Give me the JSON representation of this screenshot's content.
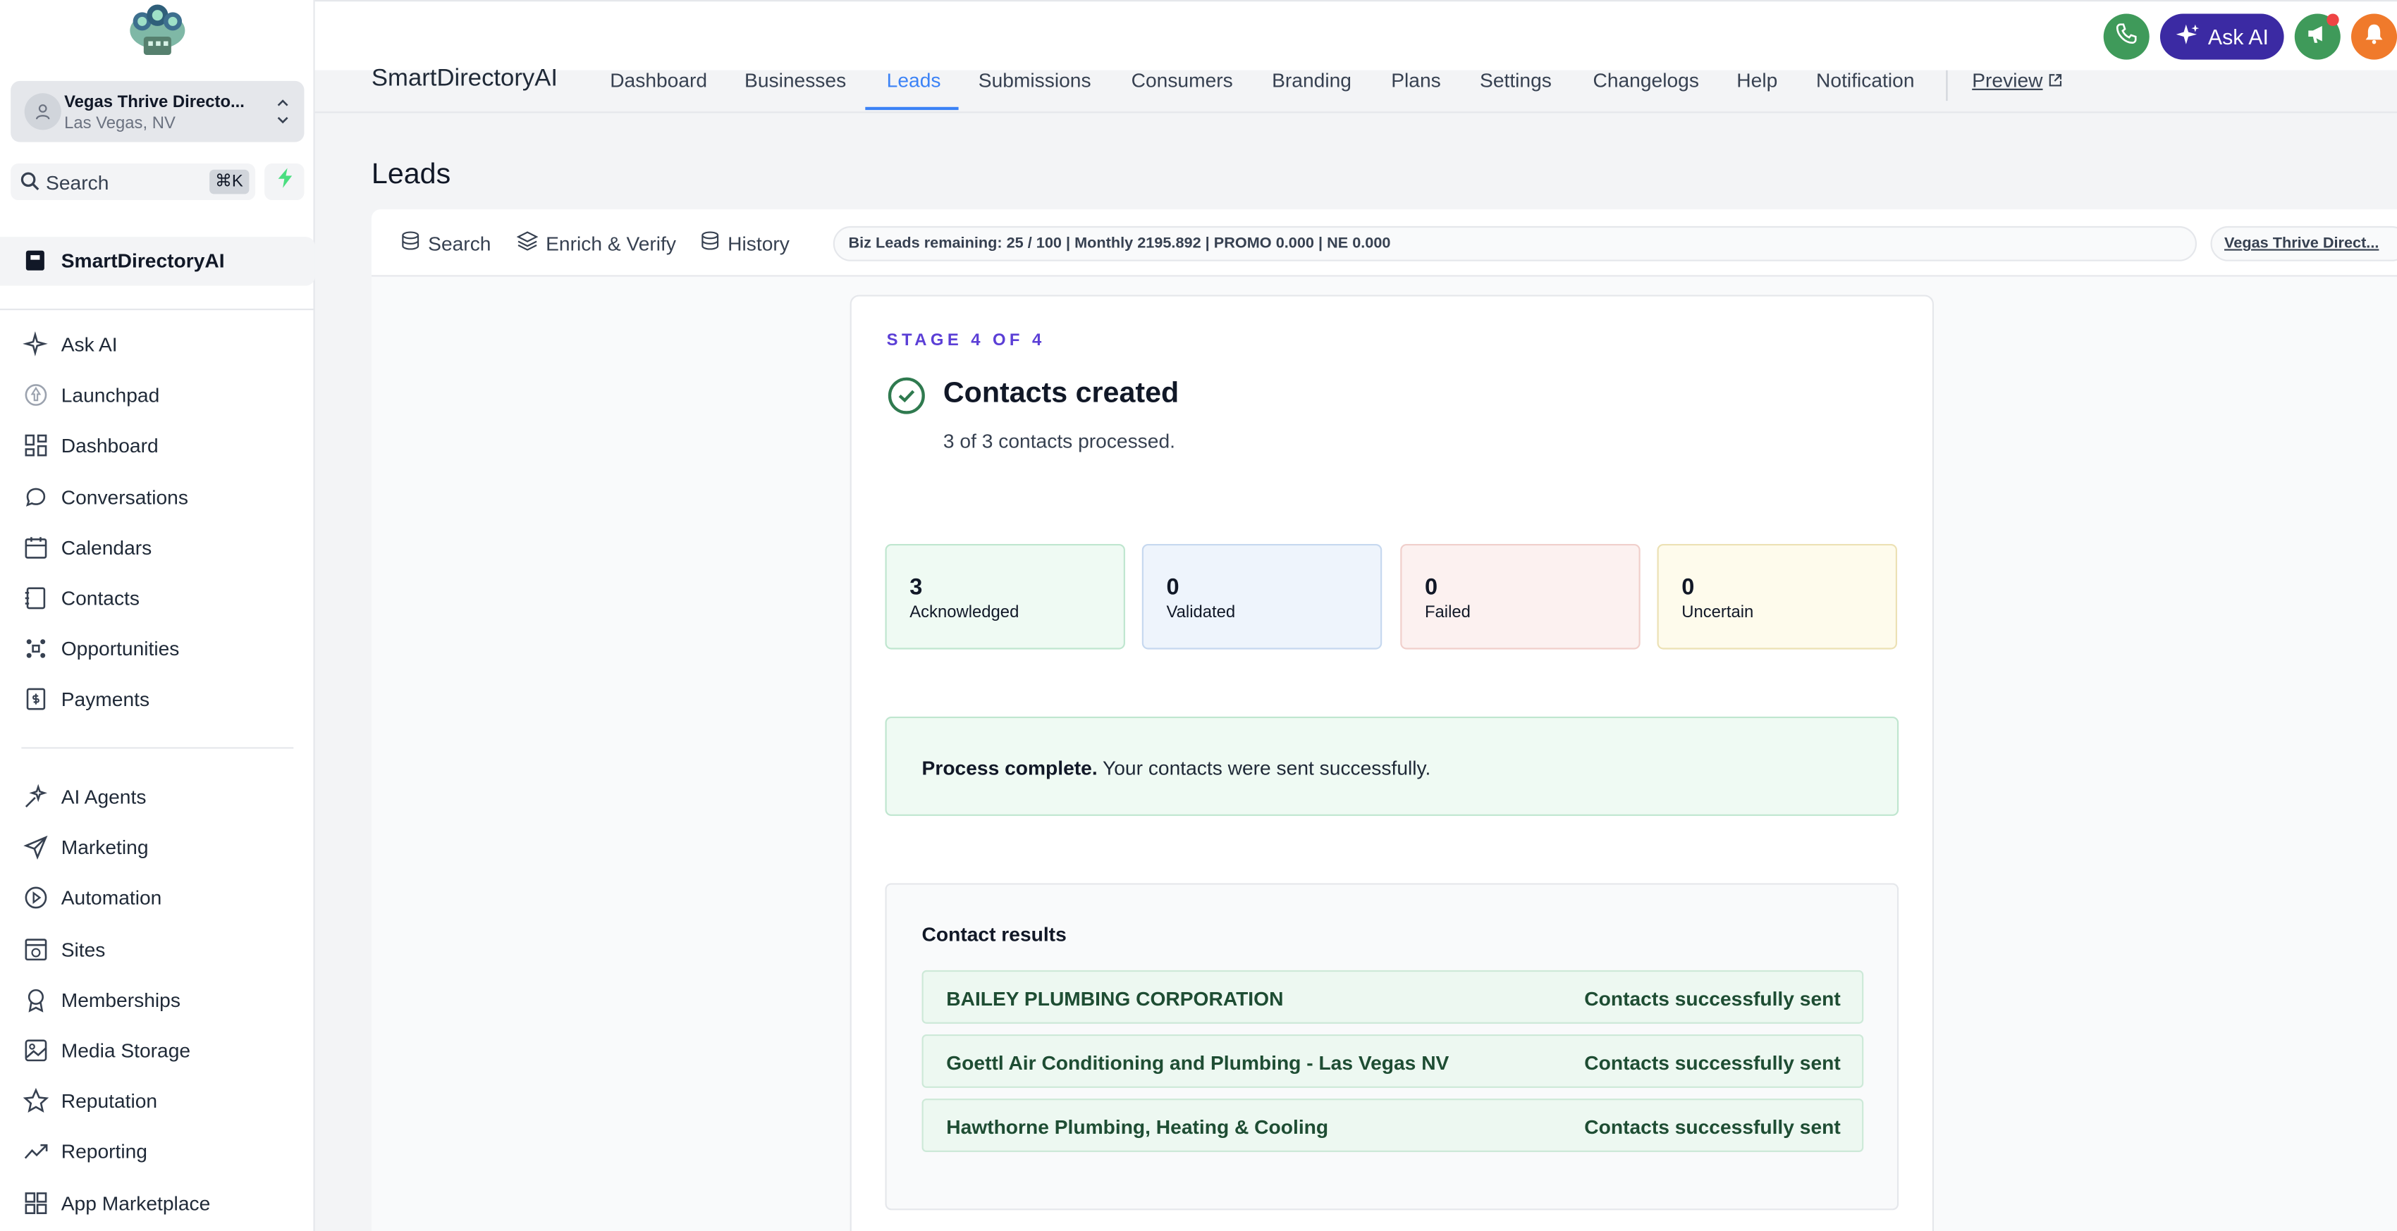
{
  "sidebar": {
    "account": {
      "name": "Vegas Thrive Directo...",
      "location": "Las Vegas, NV"
    },
    "search": {
      "label": "Search",
      "shortcut": "⌘K"
    },
    "active_item": "SmartDirectoryAI",
    "items_top": [
      {
        "label": "Ask AI",
        "icon": "sparkle-icon"
      },
      {
        "label": "Launchpad",
        "icon": "rocket-icon"
      },
      {
        "label": "Dashboard",
        "icon": "grid-icon"
      },
      {
        "label": "Conversations",
        "icon": "chat-icon"
      },
      {
        "label": "Calendars",
        "icon": "calendar-icon"
      },
      {
        "label": "Contacts",
        "icon": "contacts-icon"
      },
      {
        "label": "Opportunities",
        "icon": "opportunities-icon"
      },
      {
        "label": "Payments",
        "icon": "payments-icon"
      }
    ],
    "items_bottom": [
      {
        "label": "AI Agents",
        "icon": "ai-agents-icon"
      },
      {
        "label": "Marketing",
        "icon": "send-icon"
      },
      {
        "label": "Automation",
        "icon": "automation-icon"
      },
      {
        "label": "Sites",
        "icon": "sites-icon"
      },
      {
        "label": "Memberships",
        "icon": "badge-icon"
      },
      {
        "label": "Media Storage",
        "icon": "image-icon"
      },
      {
        "label": "Reputation",
        "icon": "star-icon"
      },
      {
        "label": "Reporting",
        "icon": "chart-line-icon"
      },
      {
        "label": "App Marketplace",
        "icon": "apps-icon"
      }
    ]
  },
  "header": {
    "ask_ai": "Ask AI",
    "brand": "SmartDirectoryAI",
    "tabs": [
      "Dashboard",
      "Businesses",
      "Leads",
      "Submissions",
      "Consumers",
      "Branding",
      "Plans",
      "Settings",
      "Changelogs",
      "Help",
      "Notification"
    ],
    "active_tab": "Leads",
    "preview": "Preview",
    "colors": {
      "accent": "#3b82f6",
      "ask_ai_bg": "#3b2aa3",
      "phone": "#3f9a5a",
      "bell": "#f07a2b"
    }
  },
  "page": {
    "title": "Leads"
  },
  "toolbar": {
    "search": "Search",
    "enrich": "Enrich & Verify",
    "history": "History",
    "quota": "Biz Leads remaining: 25 / 100 | Monthly 2195.892 | PROMO 0.000 | NE 0.000",
    "account": "Vegas Thrive Direct..."
  },
  "stage_card": {
    "stage": "STAGE 4 OF 4",
    "title": "Contacts created",
    "subtitle": "3 of 3 contacts processed.",
    "stats": [
      {
        "value": "3",
        "label": "Acknowledged"
      },
      {
        "value": "0",
        "label": "Validated"
      },
      {
        "value": "0",
        "label": "Failed"
      },
      {
        "value": "0",
        "label": "Uncertain"
      }
    ],
    "banner": {
      "bold": "Process complete.",
      "text": "Your contacts were sent successfully."
    },
    "results": {
      "heading": "Contact results",
      "rows": [
        {
          "name": "BAILEY PLUMBING CORPORATION",
          "status": "Contacts successfully sent"
        },
        {
          "name": "Goettl Air Conditioning and Plumbing - Las Vegas NV",
          "status": "Contacts successfully sent"
        },
        {
          "name": "Hawthorne Plumbing, Heating & Cooling",
          "status": "Contacts successfully sent"
        }
      ]
    }
  }
}
